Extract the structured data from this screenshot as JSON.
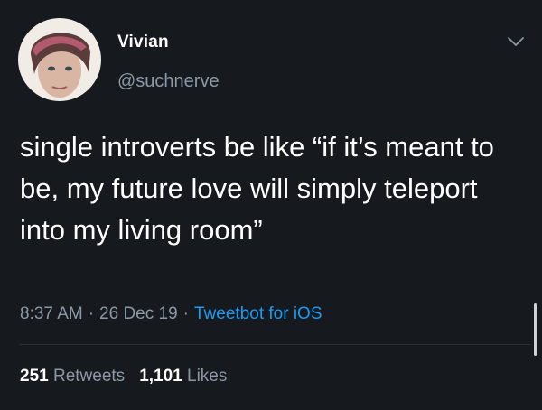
{
  "user": {
    "display_name": "Vivian",
    "handle": "@suchnerve"
  },
  "tweet": {
    "text": "single introverts be like “if it’s meant to be, my future love will simply teleport into my living room”",
    "time": "8:37 AM",
    "date": "26 Dec 19",
    "source": "Tweetbot for iOS",
    "separator": "·"
  },
  "stats": {
    "retweets_count": "251",
    "retweets_label": "Retweets",
    "likes_count": "1,101",
    "likes_label": "Likes"
  },
  "icons": {
    "menu": "chevron-down-icon"
  },
  "colors": {
    "background": "#161a1f",
    "secondary_text": "#8b98a5",
    "link": "#1d9bf0"
  }
}
